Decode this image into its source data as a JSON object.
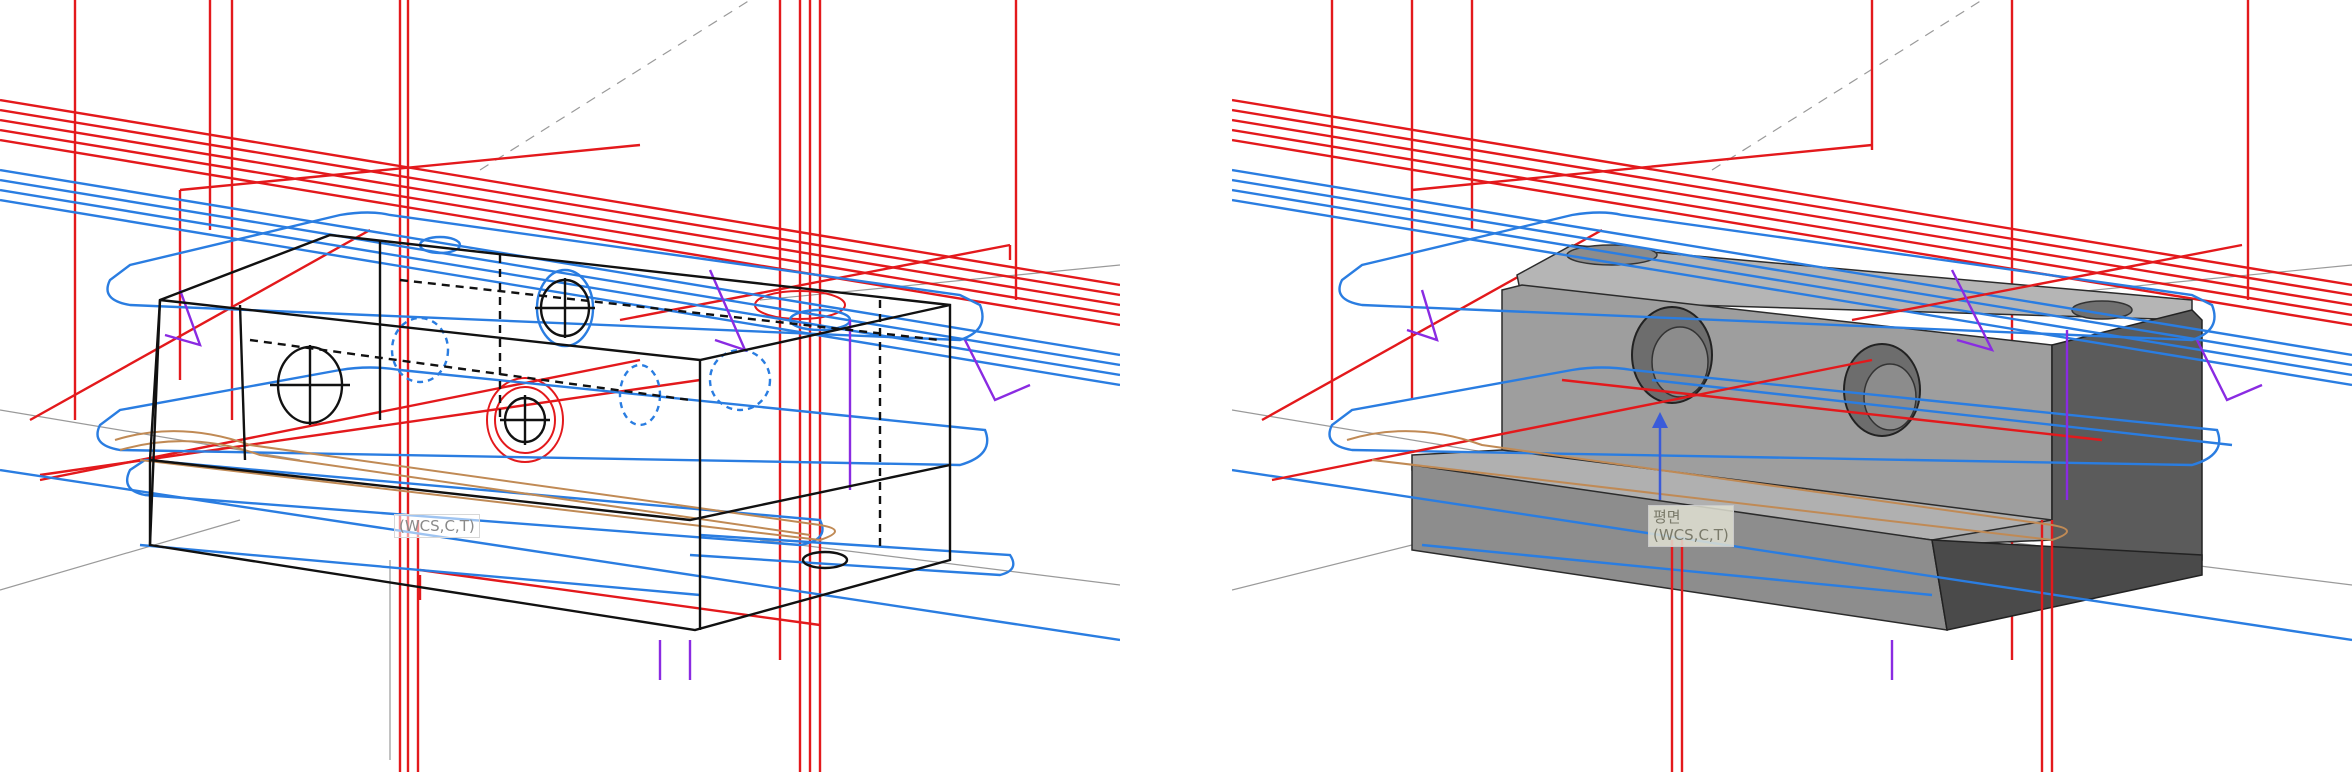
{
  "viewports": {
    "left": {
      "mode": "wireframe",
      "wcs_label": "(WCS,C,T)"
    },
    "right": {
      "mode": "shaded",
      "plane_label": "평면",
      "wcs_label": "(WCS,C,T)"
    }
  },
  "colors": {
    "rapid_moves": "#e3191c",
    "cut_moves": "#2a7de1",
    "lead_moves": "#8a2be2",
    "approach_moves": "#c08a55",
    "part_shaded": "#9a9a9a",
    "part_edge": "#111111",
    "background": "#ffffff"
  }
}
